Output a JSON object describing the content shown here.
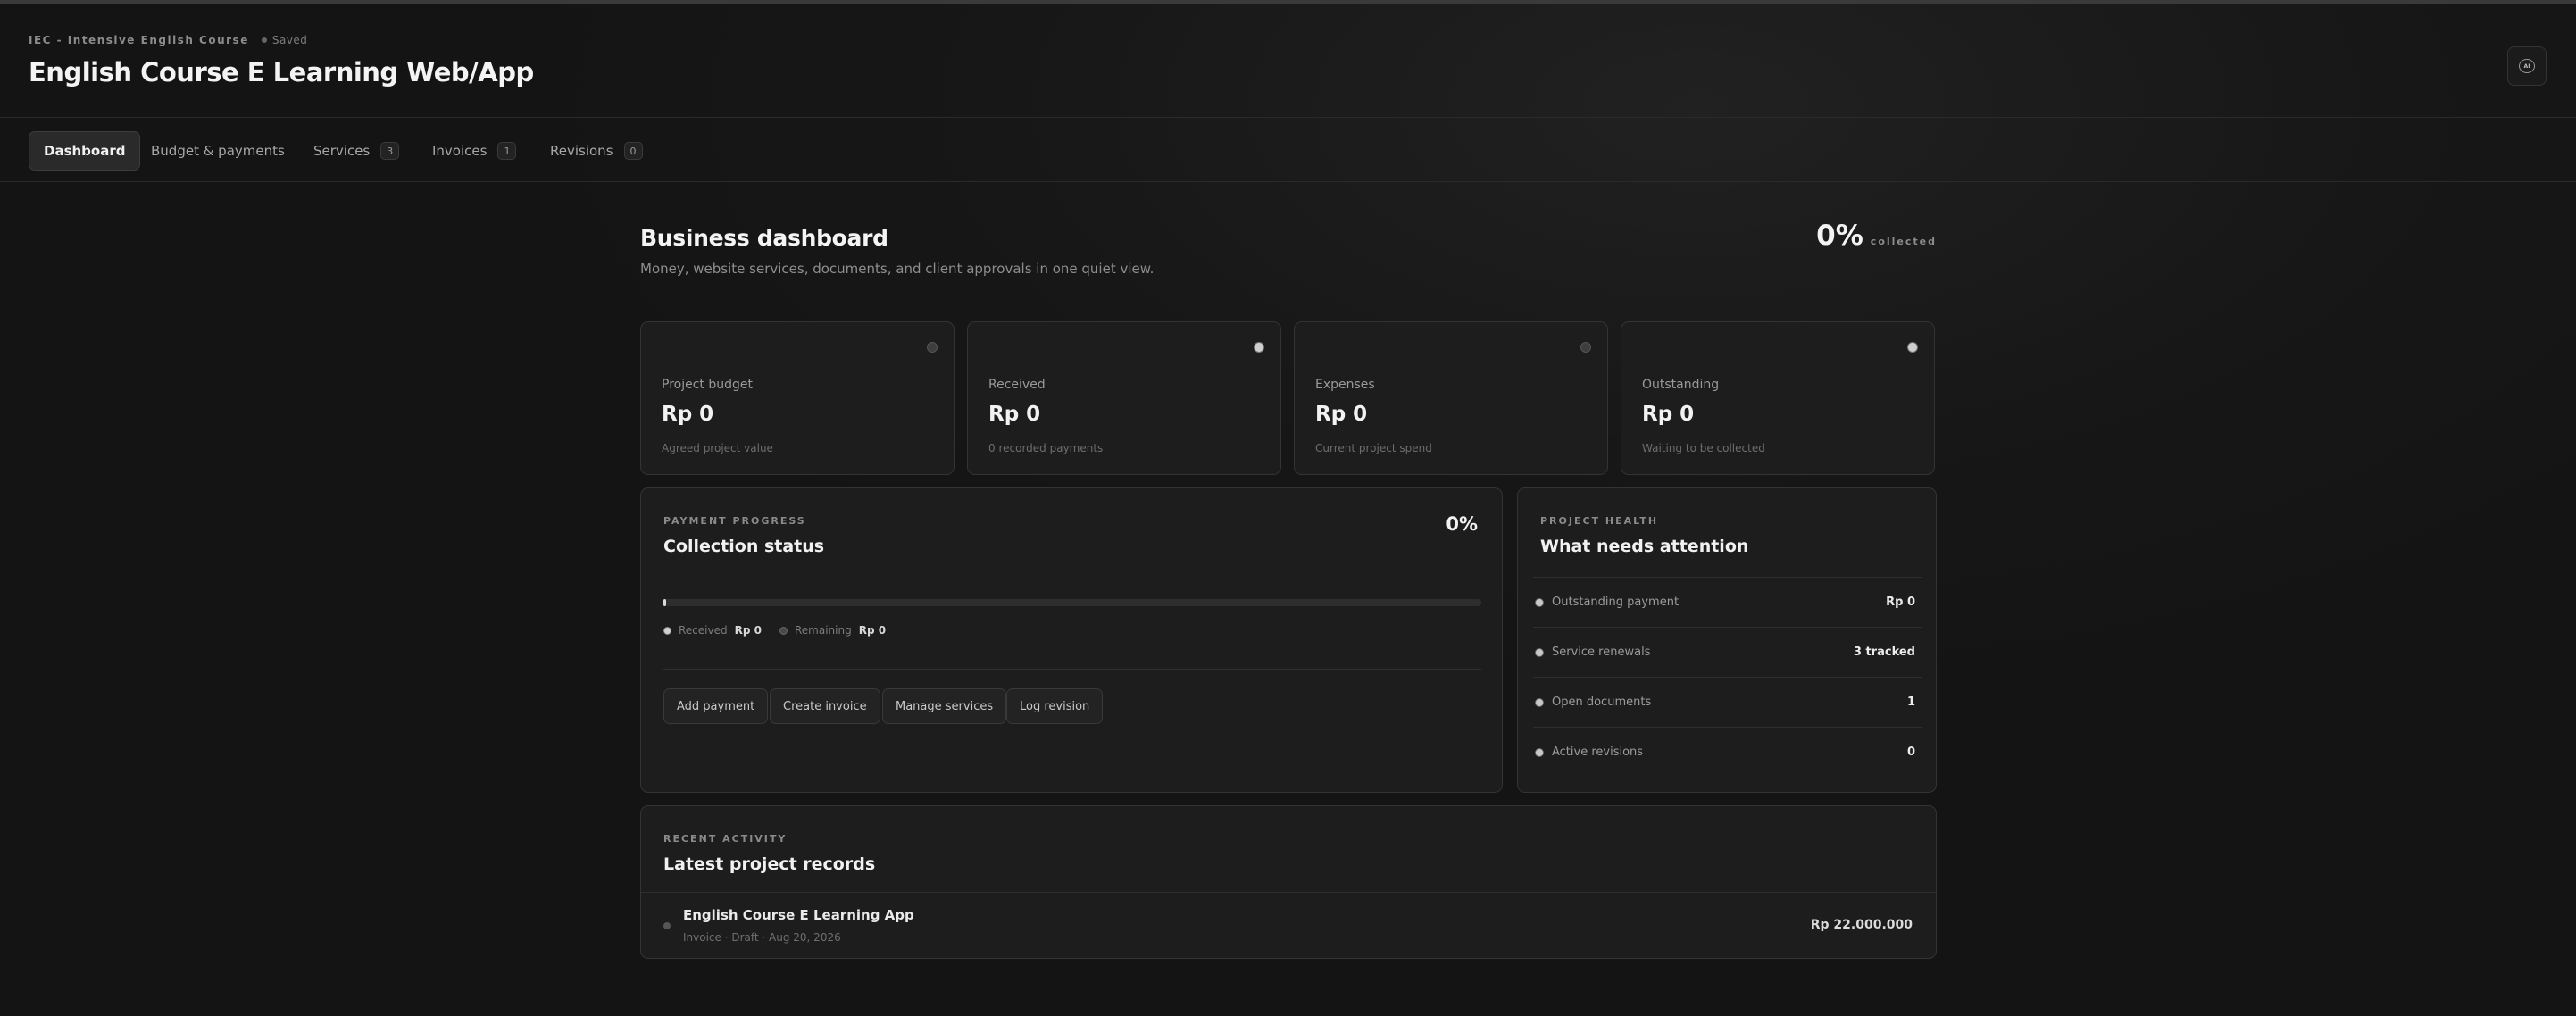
{
  "header": {
    "kicker": "IEC - Intensive English Course",
    "save_status": "Saved",
    "title": "English Course E Learning Web/App",
    "ai_button_label": "AI"
  },
  "tabs": [
    {
      "label": "Dashboard",
      "badge": null,
      "active": true
    },
    {
      "label": "Budget & payments",
      "badge": null,
      "active": false
    },
    {
      "label": "Services",
      "badge": "3",
      "active": false
    },
    {
      "label": "Invoices",
      "badge": "1",
      "active": false
    },
    {
      "label": "Revisions",
      "badge": "0",
      "active": false
    }
  ],
  "dashboard": {
    "title": "Business dashboard",
    "subtitle": "Money, website services, documents, and client approvals in one quiet view.",
    "collected_value": "0%",
    "collected_label": "collected"
  },
  "stats": [
    {
      "label": "Project budget",
      "value": "Rp 0",
      "note": "Agreed project value"
    },
    {
      "label": "Received",
      "value": "Rp 0",
      "note": "0 recorded payments"
    },
    {
      "label": "Expenses",
      "value": "Rp 0",
      "note": "Current project spend"
    },
    {
      "label": "Outstanding",
      "value": "Rp 0",
      "note": "Waiting to be collected"
    }
  ],
  "payment": {
    "kicker": "PAYMENT PROGRESS",
    "title": "Collection status",
    "percent": "0%",
    "progress_fraction": 0,
    "received_label": "Received",
    "received_value": "Rp 0",
    "remaining_label": "Remaining",
    "remaining_value": "Rp 0",
    "actions": [
      "Add payment",
      "Create invoice",
      "Manage services",
      "Log revision"
    ]
  },
  "health": {
    "kicker": "PROJECT HEALTH",
    "title": "What needs attention",
    "rows": [
      {
        "label": "Outstanding payment",
        "value": "Rp 0"
      },
      {
        "label": "Service renewals",
        "value": "3 tracked"
      },
      {
        "label": "Open documents",
        "value": "1"
      },
      {
        "label": "Active revisions",
        "value": "0"
      }
    ]
  },
  "activity": {
    "kicker": "RECENT ACTIVITY",
    "title": "Latest project records",
    "items": [
      {
        "title": "English Course E Learning App",
        "meta": "Invoice · Draft · Aug 20, 2026",
        "amount": "Rp 22.000.000"
      }
    ]
  }
}
